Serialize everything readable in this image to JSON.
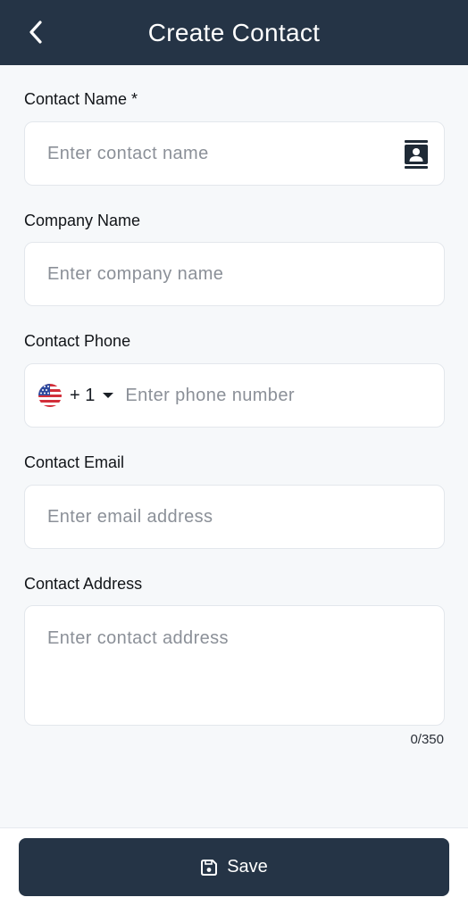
{
  "header": {
    "title": "Create Contact",
    "back_icon": "chevron-left-icon"
  },
  "form": {
    "contact_name": {
      "label": "Contact Name *",
      "placeholder": "Enter contact name",
      "value": "",
      "action_icon": "contact-book-icon"
    },
    "company_name": {
      "label": "Company Name",
      "placeholder": "Enter company name",
      "value": ""
    },
    "contact_phone": {
      "label": "Contact Phone",
      "country_flag_icon": "us-flag-icon",
      "dial_code": "+ 1",
      "dropdown_icon": "caret-down-icon",
      "placeholder": "Enter phone number",
      "value": ""
    },
    "contact_email": {
      "label": "Contact Email",
      "placeholder": "Enter email address",
      "value": ""
    },
    "contact_address": {
      "label": "Contact Address",
      "placeholder": "Enter contact address",
      "value": "",
      "counter": "0/350"
    }
  },
  "footer": {
    "save_label": "Save",
    "save_icon": "save-icon"
  },
  "colors": {
    "primary": "#253446",
    "background": "#f6f8fa",
    "field_background": "#ffffff",
    "field_border": "#e3e7ec",
    "placeholder": "#8b9098"
  }
}
